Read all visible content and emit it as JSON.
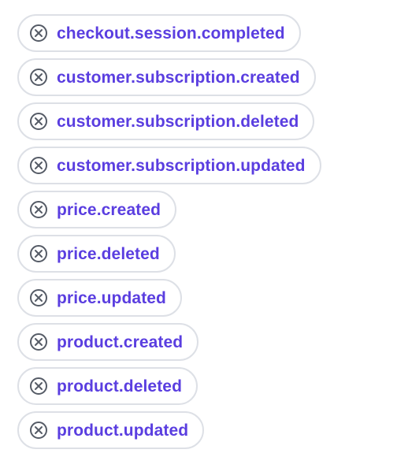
{
  "colors": {
    "chip_text": "#5a3ee0",
    "chip_border": "#dde0e6",
    "remove_icon": "#555b66"
  },
  "icons": {
    "remove": "circle-x-icon"
  },
  "chips": [
    {
      "label": "checkout.session.completed"
    },
    {
      "label": "customer.subscription.created"
    },
    {
      "label": "customer.subscription.deleted"
    },
    {
      "label": "customer.subscription.updated"
    },
    {
      "label": "price.created"
    },
    {
      "label": "price.deleted"
    },
    {
      "label": "price.updated"
    },
    {
      "label": "product.created"
    },
    {
      "label": "product.deleted"
    },
    {
      "label": "product.updated"
    }
  ]
}
